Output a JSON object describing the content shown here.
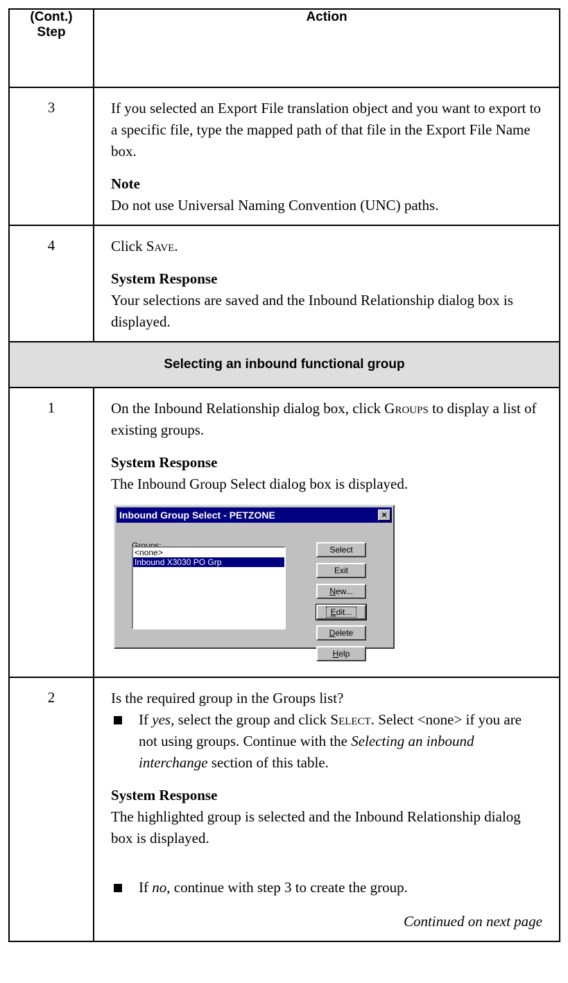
{
  "table": {
    "header_step_line1": "(Cont.)",
    "header_step_line2": "Step",
    "header_action": "Action"
  },
  "rows": {
    "r3": {
      "step": "3",
      "text": "If you selected an Export File translation object and you want to export to a specific file, type the mapped path of that file in the Export File Name box.",
      "note_label": "Note",
      "note_text": "Do not use Universal Naming Convention (UNC) paths."
    },
    "r4": {
      "step": "4",
      "click_prefix": "Click ",
      "click_cmd": "Save",
      "click_suffix": ".",
      "response_label": "System Response",
      "response_text": "Your selections are saved and the Inbound Relationship dialog box is displayed."
    },
    "section_title": "Selecting an inbound functional group",
    "g1": {
      "step": "1",
      "text_prefix": "On the Inbound Relationship dialog box, click ",
      "text_cmd": "Groups",
      "text_suffix": " to display a list of existing groups.",
      "response_label": "System Response",
      "response_text": "The Inbound Group Select dialog box is displayed."
    },
    "g2": {
      "step": "2",
      "question": "Is the required group in the Groups list?",
      "bullet1_a": "If ",
      "bullet1_yes": "yes",
      "bullet1_b": ", select the group and click ",
      "bullet1_cmd": "Select",
      "bullet1_c": ". Select <none> if you are not using groups. Continue with the ",
      "bullet1_link": "Selecting an inbound interchange",
      "bullet1_d": " section of this table.",
      "response_label": "System Response",
      "response_text": "The highlighted group is selected and the Inbound Relationship dialog box is displayed.",
      "bullet2_a": "If ",
      "bullet2_no": "no",
      "bullet2_b": ", continue with step 3 to create the group.",
      "continued": "Continued on next page"
    }
  },
  "dialog": {
    "title": "Inbound Group Select - PETZONE",
    "close_glyph": "×",
    "groups_label_u": "G",
    "groups_label_rest": "roups:",
    "list_items": [
      "<none>",
      "Inbound X3030 PO Grp"
    ],
    "buttons": {
      "select": "Select",
      "exit": "Exit",
      "new_u": "N",
      "new_rest": "ew...",
      "edit_u": "E",
      "edit_rest": "dit...",
      "delete_u": "D",
      "delete_rest": "elete",
      "help_u": "H",
      "help_rest": "elp"
    }
  }
}
